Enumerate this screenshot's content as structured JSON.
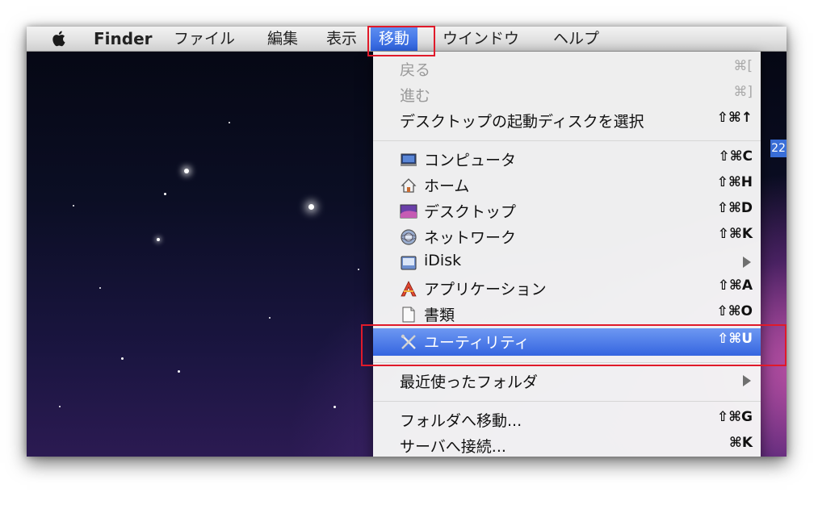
{
  "menubar": {
    "apple_icon": "apple-logo-icon",
    "items": [
      {
        "label": "Finder"
      },
      {
        "label": "ファイル"
      },
      {
        "label": "編集"
      },
      {
        "label": "表示"
      },
      {
        "label": "移動"
      },
      {
        "label": "ウインドウ"
      },
      {
        "label": "ヘルプ"
      }
    ],
    "active_index": 4
  },
  "menu": {
    "items": [
      {
        "label": "戻る",
        "shortcut": "⌘[",
        "disabled": true
      },
      {
        "label": "進む",
        "shortcut": "⌘]",
        "disabled": true
      },
      {
        "label": "デスクトップの起動ディスクを選択",
        "shortcut": "⇧⌘↑"
      },
      {
        "label": "コンピュータ",
        "shortcut": "⇧⌘C",
        "icon": "computer-icon"
      },
      {
        "label": "ホーム",
        "shortcut": "⇧⌘H",
        "icon": "home-icon"
      },
      {
        "label": "デスクトップ",
        "shortcut": "⇧⌘D",
        "icon": "desktop-icon"
      },
      {
        "label": "ネットワーク",
        "shortcut": "⇧⌘K",
        "icon": "network-icon"
      },
      {
        "label": "iDisk",
        "icon": "idisk-icon",
        "submenu": true
      },
      {
        "label": "アプリケーション",
        "shortcut": "⇧⌘A",
        "icon": "applications-icon"
      },
      {
        "label": "書類",
        "shortcut": "⇧⌘O",
        "icon": "documents-icon"
      },
      {
        "label": "ユーティリティ",
        "shortcut": "⇧⌘U",
        "icon": "utilities-icon",
        "selected": true
      },
      {
        "label": "最近使ったフォルダ",
        "submenu": true
      },
      {
        "label": "フォルダへ移動...",
        "shortcut": "⇧⌘G"
      },
      {
        "label": "サーバへ接続...",
        "shortcut": "⌘K"
      }
    ]
  },
  "desktop": {
    "badge_text": "22"
  },
  "colors": {
    "highlight": "#e01a2a",
    "selection": "#3565e0"
  }
}
